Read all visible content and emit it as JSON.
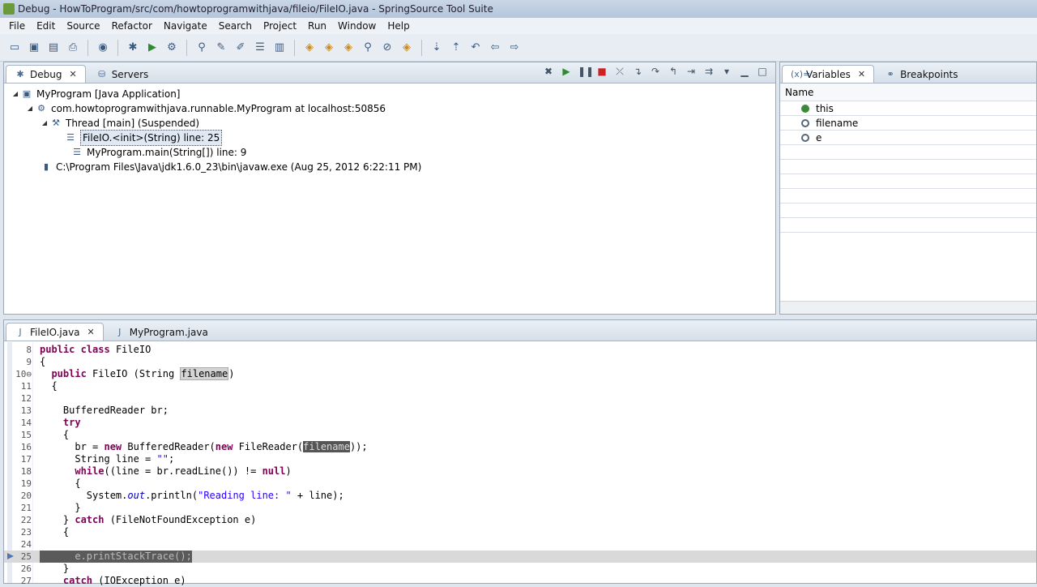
{
  "window": {
    "title": "Debug - HowToProgram/src/com/howtoprogramwithjava/fileio/FileIO.java - SpringSource Tool Suite"
  },
  "menu": [
    "File",
    "Edit",
    "Source",
    "Refactor",
    "Navigate",
    "Search",
    "Project",
    "Run",
    "Window",
    "Help"
  ],
  "debug_panel": {
    "tabs": [
      {
        "label": "Debug",
        "active": true
      },
      {
        "label": "Servers",
        "active": false
      }
    ],
    "tree": [
      {
        "label": "MyProgram [Java Application]",
        "level": 0,
        "icon": "app-icon"
      },
      {
        "label": "com.howtoprogramwithjava.runnable.MyProgram at localhost:50856",
        "level": 1,
        "icon": "vm-icon"
      },
      {
        "label": "Thread [main] (Suspended)",
        "level": 2,
        "icon": "thread-icon"
      },
      {
        "label": "FileIO.<init>(String) line: 25",
        "level": 3,
        "icon": "stack-frame-icon",
        "selected": true
      },
      {
        "label": "MyProgram.main(String[]) line: 9",
        "level": 3,
        "icon": "stack-frame-icon"
      },
      {
        "label": "C:\\Program Files\\Java\\jdk1.6.0_23\\bin\\javaw.exe (Aug 25, 2012 6:22:11 PM)",
        "level": 1,
        "icon": "process-icon"
      }
    ]
  },
  "variables_panel": {
    "tabs": [
      {
        "label": "Variables",
        "active": true
      },
      {
        "label": "Breakpoints",
        "active": false
      }
    ],
    "column_header": "Name",
    "rows": [
      {
        "name": "this",
        "kind": "field"
      },
      {
        "name": "filename",
        "kind": "local"
      },
      {
        "name": "e",
        "kind": "local"
      }
    ]
  },
  "editor": {
    "tabs": [
      {
        "label": "FileIO.java",
        "active": true
      },
      {
        "label": "MyProgram.java",
        "active": false
      }
    ],
    "lines": [
      {
        "n": "8",
        "text": "public class FileIO"
      },
      {
        "n": "9",
        "text": "{"
      },
      {
        "n": "10⊖",
        "text": "  public FileIO (String filename)"
      },
      {
        "n": "11",
        "text": "  {"
      },
      {
        "n": "12",
        "text": ""
      },
      {
        "n": "13",
        "text": "    BufferedReader br;"
      },
      {
        "n": "14",
        "text": "    try"
      },
      {
        "n": "15",
        "text": "    {"
      },
      {
        "n": "16",
        "text": "      br = new BufferedReader(new FileReader(filename));"
      },
      {
        "n": "17",
        "text": "      String line = \"\";"
      },
      {
        "n": "18",
        "text": "      while((line = br.readLine()) != null)"
      },
      {
        "n": "19",
        "text": "      {"
      },
      {
        "n": "20",
        "text": "        System.out.println(\"Reading line: \" + line);"
      },
      {
        "n": "21",
        "text": "      }"
      },
      {
        "n": "22",
        "text": "    } catch (FileNotFoundException e)"
      },
      {
        "n": "23",
        "text": "    {"
      },
      {
        "n": "24",
        "text": ""
      },
      {
        "n": "25",
        "text": "      e.printStackTrace();"
      },
      {
        "n": "26",
        "text": "    }"
      },
      {
        "n": "27",
        "text": "    catch (IOException e)"
      }
    ],
    "current_line": "25"
  }
}
